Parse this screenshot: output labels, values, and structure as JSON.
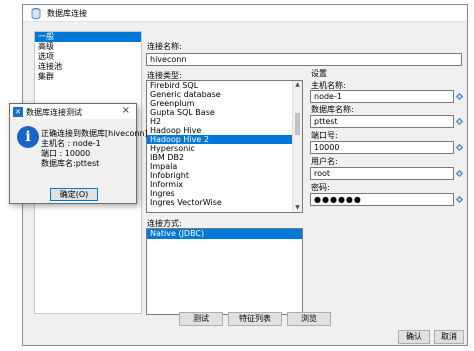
{
  "window": {
    "title": "数据库连接"
  },
  "sidebar": {
    "items": [
      "一般",
      "高级",
      "选项",
      "连接池",
      "集群"
    ]
  },
  "conn_name": {
    "label": "连接名称:",
    "value": "hiveconn"
  },
  "conn_type": {
    "label": "连接类型:",
    "items": [
      "Firebird SQL",
      "Generic database",
      "Greenplum",
      "Gupta SQL Base",
      "H2",
      "Hadoop Hive",
      "Hadoop Hive 2",
      "Hypersonic",
      "IBM DB2",
      "Impala",
      "Infobright",
      "Informix",
      "Ingres",
      "Ingres VectorWise"
    ],
    "selected": "Hadoop Hive 2"
  },
  "access": {
    "label": "连接方式:",
    "items": [
      "Native (JDBC)"
    ]
  },
  "settings": {
    "title": "设置",
    "host_label": "主机名称:",
    "host_value": "node-1",
    "db_label": "数据库名称:",
    "db_value": "pttest",
    "port_label": "端口号:",
    "port_value": "10000",
    "user_label": "用户名:",
    "user_value": "root",
    "pass_label": "密码:",
    "pass_value": "●●●●●●"
  },
  "buttons": {
    "test": "测试",
    "features": "特征列表",
    "explore": "浏览",
    "ok": "确认",
    "cancel": "取消"
  },
  "dialog": {
    "title": "数据库连接测试",
    "close": "×",
    "line1": "正确连接到数据库[hiveconn]",
    "line2": "主机名    : node-1",
    "line3": "端口      : 10000",
    "line4": "数据库名:pttest",
    "ok": "确定(O)"
  },
  "icons": {
    "window": "database-icon",
    "dialog": "app-icon",
    "info": "info-icon",
    "diamond": "variable-diamond-icon"
  }
}
